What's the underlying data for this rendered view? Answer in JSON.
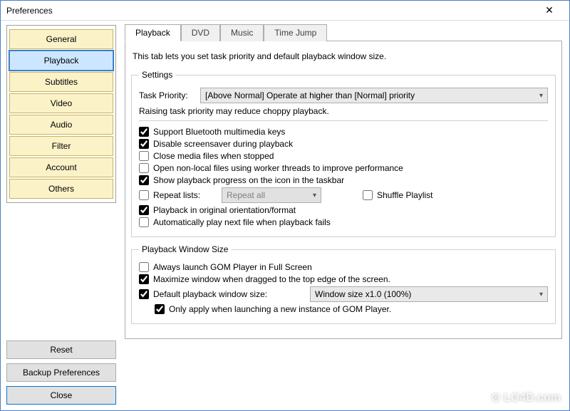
{
  "window": {
    "title": "Preferences",
    "close_glyph": "✕"
  },
  "sidebar": {
    "items": [
      "General",
      "Playback",
      "Subtitles",
      "Video",
      "Audio",
      "Filter",
      "Account",
      "Others"
    ],
    "active_index": 1,
    "reset": "Reset",
    "backup": "Backup Preferences",
    "close": "Close"
  },
  "tabs": {
    "items": [
      "Playback",
      "DVD",
      "Music",
      "Time Jump"
    ],
    "active_index": 0
  },
  "page": {
    "intro": "This tab lets you set task priority and default playback window size.",
    "settings": {
      "legend": "Settings",
      "task_priority_label": "Task Priority:",
      "task_priority_value": "[Above Normal] Operate at higher than [Normal] priority",
      "task_priority_hint": "Raising task priority may reduce choppy playback.",
      "opts": {
        "bluetooth": "Support Bluetooth multimedia keys",
        "screensaver": "Disable screensaver during playback",
        "close_stop": "Close media files when stopped",
        "worker": "Open non-local files using worker threads to improve performance",
        "taskbar": "Show playback progress on the icon in the taskbar",
        "repeat": "Repeat lists:",
        "repeat_value": "Repeat all",
        "shuffle": "Shuffle Playlist",
        "orientation": "Playback in original orientation/format",
        "autonext": "Automatically play next file when playback fails"
      },
      "checked": {
        "bluetooth": true,
        "screensaver": true,
        "close_stop": false,
        "worker": false,
        "taskbar": true,
        "repeat": false,
        "shuffle": false,
        "orientation": true,
        "autonext": false
      }
    },
    "winsize": {
      "legend": "Playback Window Size",
      "fullscreen": "Always launch GOM Player in Full Screen",
      "maximize": "Maximize window when dragged to the top edge of the screen.",
      "defsize": "Default playback window size:",
      "defsize_value": "Window size x1.0 (100%)",
      "onlynew": "Only apply when launching a new instance of GOM Player.",
      "checked": {
        "fullscreen": false,
        "maximize": true,
        "defsize": true,
        "onlynew": true
      }
    }
  },
  "watermark": "⊙ LO4D.com"
}
